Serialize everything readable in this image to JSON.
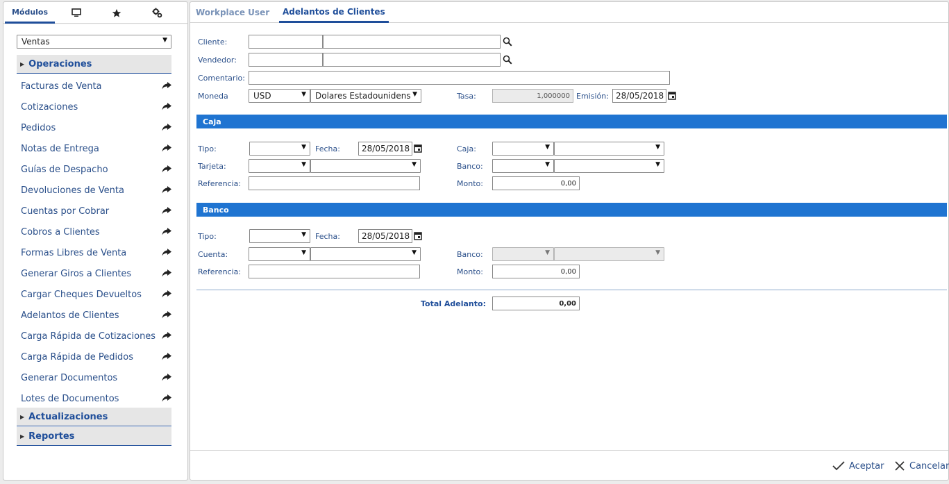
{
  "left_tabs": [
    {
      "label": "Módulos",
      "icon": "modules-tab"
    },
    {
      "label": "",
      "icon": "monitor-icon"
    },
    {
      "label": "",
      "icon": "star-icon"
    },
    {
      "label": "",
      "icon": "settings-gears-icon"
    }
  ],
  "module_select": {
    "value": "Ventas"
  },
  "sections": {
    "operaciones": "Operaciones",
    "actualizaciones": "Actualizaciones",
    "reportes": "Reportes"
  },
  "menu_items": [
    "Facturas de Venta",
    "Cotizaciones",
    "Pedidos",
    "Notas de Entrega",
    "Guías de Despacho",
    "Devoluciones de Venta",
    "Cuentas por Cobrar",
    "Cobros a Clientes",
    "Formas Libres de Venta",
    "Generar Giros a Clientes",
    "Cargar Cheques Devueltos",
    "Adelantos de Clientes",
    "Carga Rápida de Cotizaciones",
    "Carga Rápida de Pedidos",
    "Generar Documentos",
    "Lotes de Documentos"
  ],
  "tabs": {
    "workplace": "Workplace User",
    "active": "Adelantos de Clientes"
  },
  "form": {
    "cliente_label": "Cliente:",
    "vendedor_label": "Vendedor:",
    "comentario_label": "Comentario:",
    "moneda_label": "Moneda",
    "moneda_code": "USD",
    "moneda_name": "Dolares Estadounidens",
    "tasa_label": "Tasa:",
    "tasa_value": "1,000000",
    "emision_label": "Emisión:",
    "emision_value": "28/05/2018"
  },
  "caja": {
    "title": "Caja",
    "tipo_label": "Tipo:",
    "fecha_label": "Fecha:",
    "fecha_value": "28/05/2018",
    "caja_label": "Caja:",
    "tarjeta_label": "Tarjeta:",
    "banco_label": "Banco:",
    "referencia_label": "Referencia:",
    "monto_label": "Monto:",
    "monto_value": "0,00"
  },
  "banco": {
    "title": "Banco",
    "tipo_label": "Tipo:",
    "fecha_label": "Fecha:",
    "fecha_value": "28/05/2018",
    "cuenta_label": "Cuenta:",
    "banco_label": "Banco:",
    "referencia_label": "Referencia:",
    "monto_label": "Monto:",
    "monto_value": "0,00"
  },
  "total": {
    "label": "Total Adelanto:",
    "value": "0,00"
  },
  "footer": {
    "accept": "Aceptar",
    "cancel": "Cancelar"
  },
  "colors": {
    "accent": "#1f4e9a",
    "band": "#1f74d1"
  }
}
